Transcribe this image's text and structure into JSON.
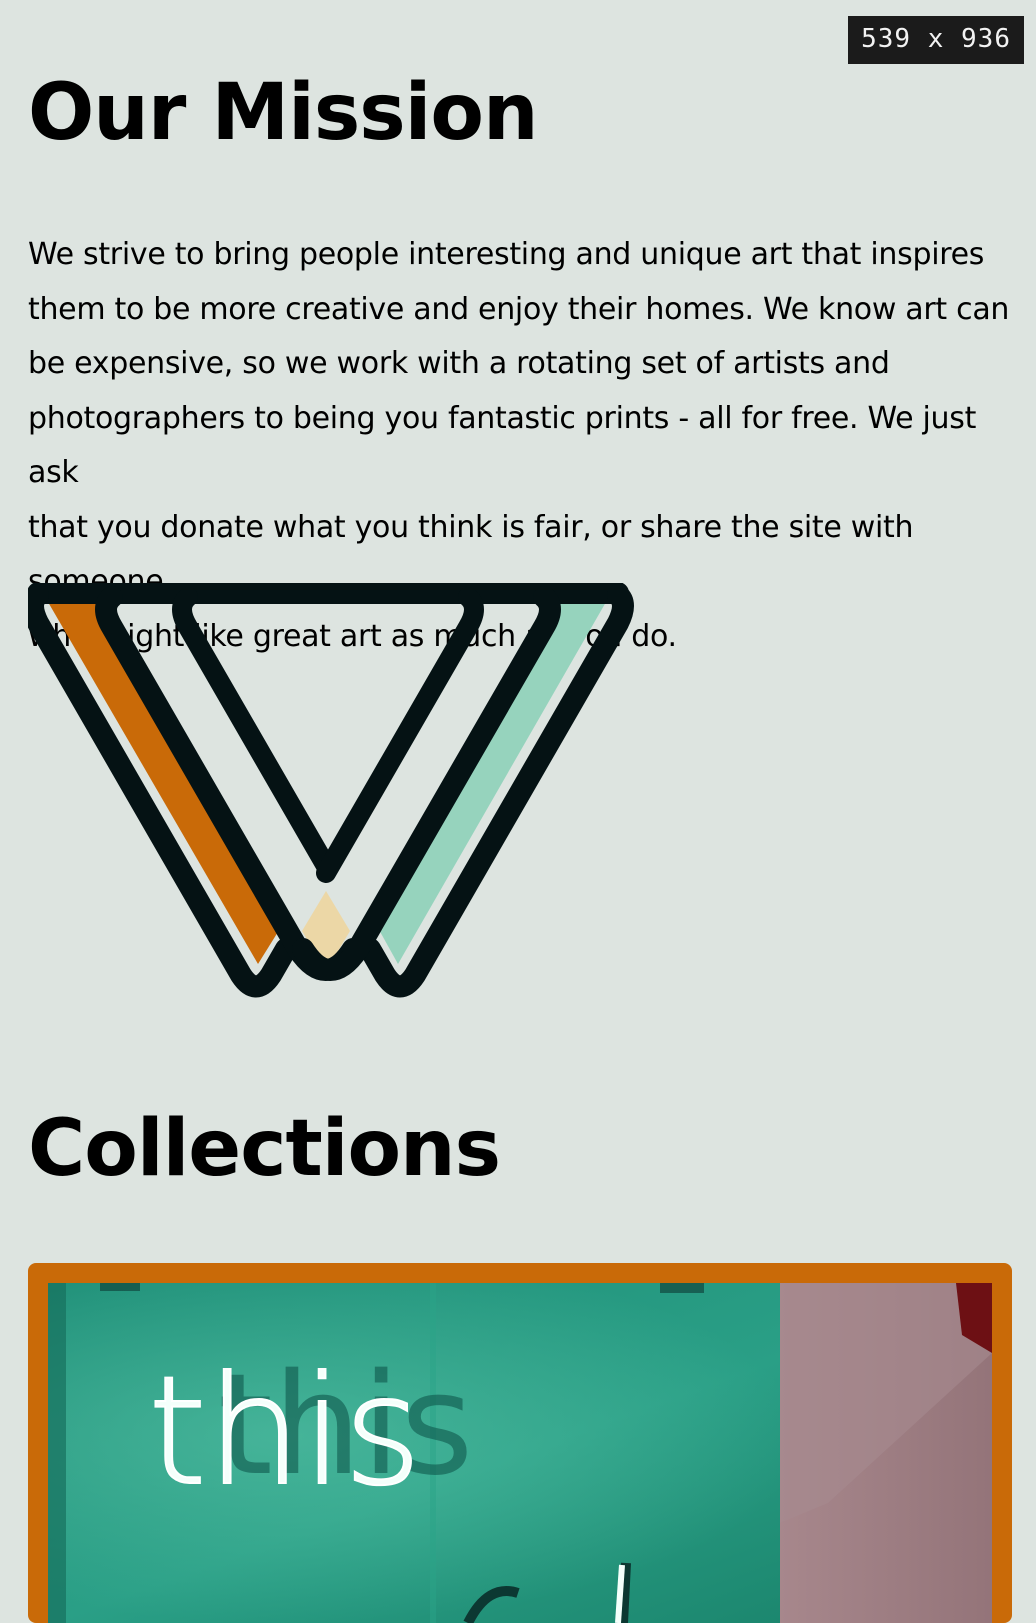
{
  "viewport_badge": "539 x 936",
  "mission": {
    "title": "Our Mission",
    "paragraph_lines": [
      "We strive to bring people interesting and unique art that inspires",
      "them to be more creative and enjoy their homes. We know art can",
      "be expensive, so we work with a rotating set of artists and",
      "photographers to being you fantastic prints - all for free. We just ask",
      "that you donate what you think is fair, or share the site with someone",
      "who might like great art as much as you do."
    ]
  },
  "logo": {
    "icon": "v-stripes-logo",
    "colors": {
      "outline": "#051214",
      "left_stripe": "#c96a08",
      "right_stripe": "#96d3bd",
      "diamond": "#ecd7a6",
      "background": "#dde4e0"
    }
  },
  "collections": {
    "title": "Collections",
    "card": {
      "border_color": "#c96a08",
      "image_subject": "neon-sign-photo",
      "neon_text": "this"
    }
  }
}
